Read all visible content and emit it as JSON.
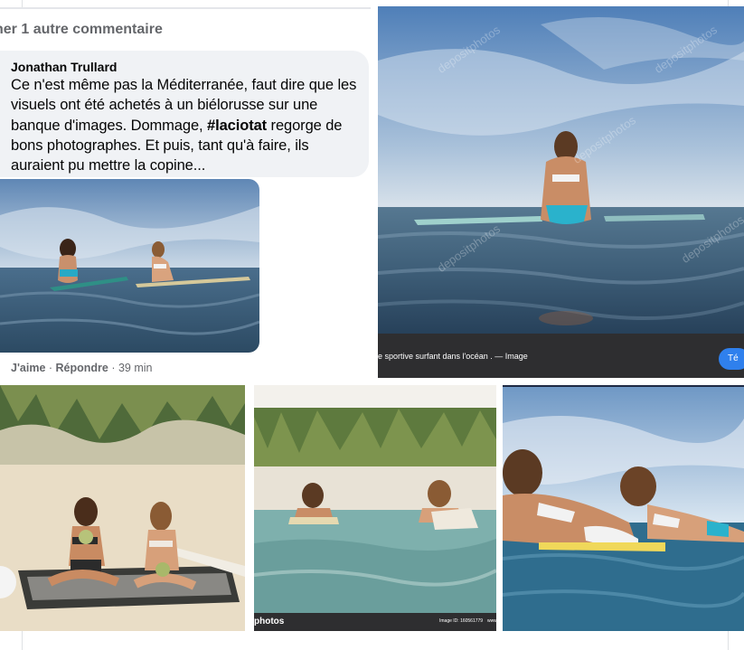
{
  "comment_panel": {
    "more_comments": "ner 1 autre commentaire",
    "author": "Jonathan Trullard",
    "text_before_tag": "Ce n'est même pas la Méditerranée, faut dire que les visuels ont été achetés à un biélorusse sur une banque d'images. Dommage, ",
    "hashtag": "#laciotat",
    "text_after_tag": " regorge de bons photographes. Et puis, tant qu'à faire, ils auraient pu mettre la copine...",
    "like_label": "J'aime",
    "separator": " · ",
    "reply_label": "Répondre",
    "time": "39 min"
  },
  "stock_page": {
    "caption": "e sportive surfant dans l'océan . — Image",
    "button_label": "Té",
    "watermark": "depositphotos"
  },
  "grid": {
    "photo_2_caption_left": "photos",
    "photo_2_caption_right": "Image ID: 160561779",
    "photo_2_caption_far": "www"
  },
  "colors": {
    "bubble_bg": "#f0f2f5",
    "secondary_text": "#65676b",
    "accent_blue": "#2f80ed"
  }
}
